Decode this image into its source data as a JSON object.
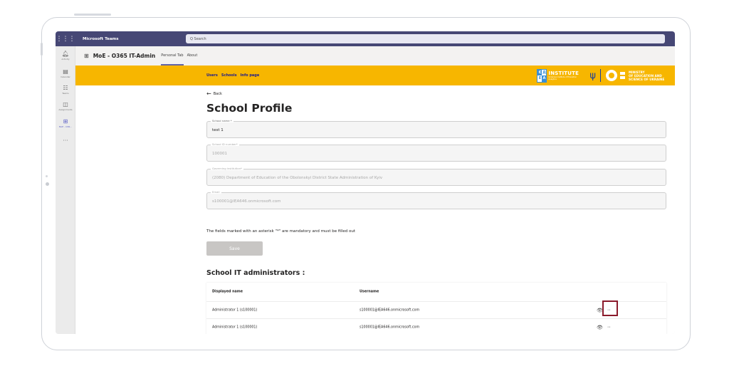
{
  "topbar": {
    "waffle_glyph": "⋮⋮⋮",
    "app_name": "Microsoft Teams",
    "search_placeholder": "Q  Search"
  },
  "rail": {
    "items": [
      {
        "icon": "bell-icon",
        "glyph": "🔔︎",
        "label": "Activity"
      },
      {
        "icon": "calendar-icon",
        "glyph": "▤",
        "label": "Calendar"
      },
      {
        "icon": "teams-icon",
        "glyph": "☷",
        "label": "Teams"
      },
      {
        "icon": "assignments-icon",
        "glyph": "◫",
        "label": "Assignments"
      },
      {
        "icon": "app-icon",
        "glyph": "⊞",
        "label": "MoE - O36..."
      }
    ],
    "more_glyph": "···"
  },
  "tabbar": {
    "app_glyph": "⊞",
    "title": "MoE - O365 IT-Admin",
    "tabs": [
      {
        "label": "Personal Tab",
        "active": true
      },
      {
        "label": "About",
        "active": false
      }
    ]
  },
  "banner": {
    "nav": [
      "Users",
      "Schools",
      "Info page"
    ],
    "iea": {
      "letters": [
        "Є",
        "Д",
        "Е",
        "А"
      ],
      "title": "INSTITUTE",
      "subtitle": "Ukrainian Institute of Education Analytics"
    },
    "trident_glyph": "ψ",
    "ministry_lines": [
      "MINISTRY",
      "OF EDUCATION AND",
      "SCIENCE OF UKRAINE"
    ]
  },
  "form": {
    "back_glyph": "←",
    "back_label": "Back",
    "title": "School Profile",
    "fields": [
      {
        "label": "School name *",
        "value": "test 1",
        "disabled": false
      },
      {
        "label": "School ID number*",
        "value": "100001",
        "disabled": true
      },
      {
        "label": "Governing institution*",
        "value": "(2080) Department of Education of the Obolonskyi District State Administration of Kyiv",
        "disabled": true
      },
      {
        "label": "Email",
        "value": "s100001@IEA646.onmicrosoft.com",
        "disabled": true
      }
    ],
    "note": "The fields marked with an asterisk \"*\" are mandatory and must be filled out",
    "save_label": "Save"
  },
  "admins": {
    "title": "School IT administrators :",
    "columns": [
      "Displayed name",
      "Username"
    ],
    "rows": [
      {
        "name": "Administrator 1 (s100001)",
        "username": "s100001@IEA646.onmicrosoft.com"
      },
      {
        "name": "Administrator 1 (s100001)",
        "username": "s100001@IEA646.onmicrosoft.com"
      }
    ],
    "eye_glyph": "👁︎",
    "more_glyph": "···"
  },
  "colors": {
    "teams_header": "#464775",
    "banner_yellow": "#f7b600",
    "highlight": "#8b1a2b"
  }
}
